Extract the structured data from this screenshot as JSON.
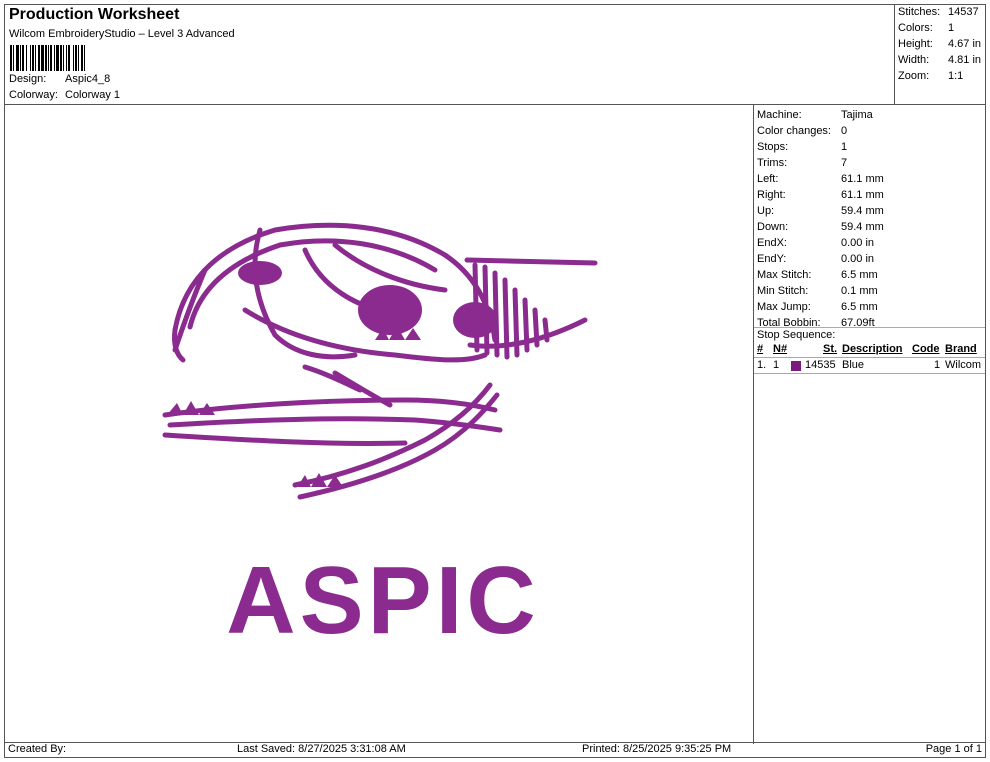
{
  "header": {
    "title": "Production Worksheet",
    "software": "Wilcom EmbroideryStudio – Level 3 Advanced",
    "design_label": "Design:",
    "design_value": "Aspic4_8",
    "colorway_label": "Colorway:",
    "colorway_value": "Colorway 1"
  },
  "summary": [
    {
      "label": "Stitches:",
      "value": "14537"
    },
    {
      "label": "Colors:",
      "value": "1"
    },
    {
      "label": "Height:",
      "value": "4.67 in"
    },
    {
      "label": "Width:",
      "value": "4.81 in"
    },
    {
      "label": "Zoom:",
      "value": "1:1"
    }
  ],
  "machine_info": [
    {
      "label": "Machine:",
      "value": "Tajima"
    },
    {
      "label": "Color changes:",
      "value": "0"
    },
    {
      "label": "Stops:",
      "value": "1"
    },
    {
      "label": "Trims:",
      "value": "7"
    },
    {
      "label": "Left:",
      "value": "61.1 mm"
    },
    {
      "label": "Right:",
      "value": "61.1 mm"
    },
    {
      "label": "Up:",
      "value": "59.4 mm"
    },
    {
      "label": "Down:",
      "value": "59.4 mm"
    },
    {
      "label": "EndX:",
      "value": "0.00 in"
    },
    {
      "label": "EndY:",
      "value": "0.00 in"
    },
    {
      "label": "Max Stitch:",
      "value": "6.5 mm"
    },
    {
      "label": "Min Stitch:",
      "value": "0.1 mm"
    },
    {
      "label": "Max Jump:",
      "value": "6.5 mm"
    },
    {
      "label": "Total Bobbin:",
      "value": "67.09ft"
    }
  ],
  "stop_sequence": {
    "title": "Stop Sequence:",
    "columns": {
      "num": "#",
      "needle": "N#",
      "stitches": "St.",
      "description": "Description",
      "code": "Code",
      "brand": "Brand"
    },
    "rows": [
      {
        "num": "1.",
        "needle": "1",
        "swatch_color": "#7a1a7e",
        "stitches": "14535",
        "description": "Blue",
        "code": "1",
        "brand": "Wilcom"
      }
    ]
  },
  "design": {
    "text": "ASPIC",
    "thread_color": "#8b2b8f"
  },
  "footer": {
    "created_by": "Created By:",
    "last_saved": "Last Saved: 8/27/2025 3:31:08 AM",
    "printed": "Printed: 8/25/2025 9:35:25 PM",
    "page": "Page 1 of 1"
  }
}
